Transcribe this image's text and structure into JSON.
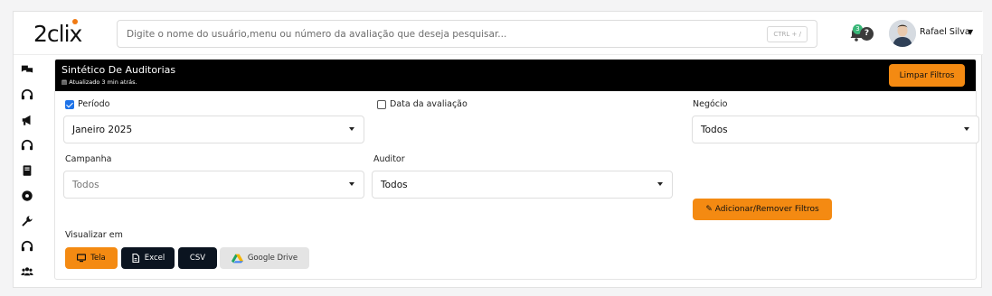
{
  "header": {
    "logo": "2clix",
    "search_placeholder": "Digite o nome do usuário,menu ou número da avaliação que deseja pesquisar...",
    "search_shortcut": "CTRL + /",
    "notification_count": "3",
    "help_label": "?",
    "user_name": "Rafael Silva"
  },
  "sidebar": {
    "items": [
      {
        "icon": "chat-icon"
      },
      {
        "icon": "headset-icon"
      },
      {
        "icon": "megaphone-icon"
      },
      {
        "icon": "headset-icon"
      },
      {
        "icon": "book-icon"
      },
      {
        "icon": "cog-icon"
      },
      {
        "icon": "wrench-icon"
      },
      {
        "icon": "headset-icon"
      },
      {
        "icon": "users-icon"
      }
    ]
  },
  "card": {
    "title": "Sintético De Auditorias",
    "updated": "Atualizado 3 min atrás.",
    "clear_filters": "Limpar Filtros"
  },
  "filters": {
    "periodo_label": "Período",
    "periodo_checked": true,
    "periodo_value": "Janeiro 2025",
    "data_avaliacao_label": "Data da avaliação",
    "data_avaliacao_checked": false,
    "negocio_label": "Negócio",
    "negocio_value": "Todos",
    "campanha_label": "Campanha",
    "campanha_value": "Todos",
    "auditor_label": "Auditor",
    "auditor_value": "Todos",
    "add_remove_filters": "Adicionar/Remover Filtros"
  },
  "visualizar": {
    "label": "Visualizar em",
    "options": [
      {
        "label": "Tela",
        "icon": "monitor-icon",
        "color": "#f48a12"
      },
      {
        "label": "Excel",
        "icon": "file-icon",
        "color": "#0b1420"
      },
      {
        "label": "CSV",
        "icon": "",
        "color": "#0b1420"
      },
      {
        "label": "Google Drive",
        "icon": "google-drive-icon",
        "color": "#e4e4e4"
      }
    ]
  },
  "colors": {
    "accent": "#f48a12",
    "header_bg": "#000000",
    "dark_button": "#0b1420",
    "badge": "#38b677"
  }
}
